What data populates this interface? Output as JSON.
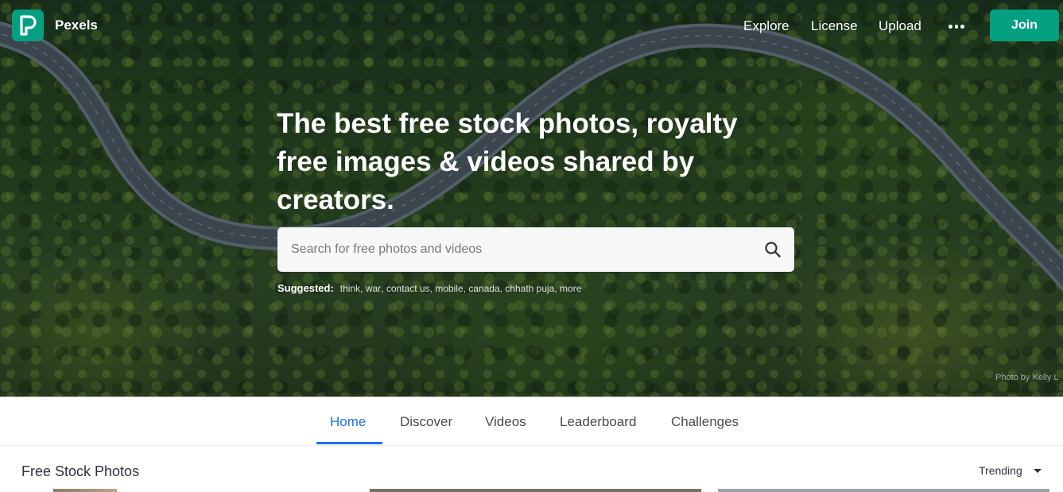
{
  "brand": {
    "name": "Pexels",
    "color": "#05a081"
  },
  "nav": {
    "links": [
      "Explore",
      "License",
      "Upload"
    ],
    "more_icon": "more-dots-icon",
    "join_label": "Join"
  },
  "hero": {
    "title": "The best free stock photos, royalty free images & videos shared by creators.",
    "search": {
      "placeholder": "Search for free photos and videos",
      "value": ""
    },
    "suggested_label": "Suggested:",
    "suggested": [
      "think",
      "war",
      "contact us",
      "mobile",
      "canada",
      "chhath puja",
      "more"
    ],
    "photo_credit": "Photo by Kelly L"
  },
  "tabs": {
    "items": [
      "Home",
      "Discover",
      "Videos",
      "Leaderboard",
      "Challenges"
    ],
    "active": "Home",
    "active_color": "#1a73e8"
  },
  "section": {
    "title": "Free Stock Photos",
    "sort_value": "Trending"
  }
}
